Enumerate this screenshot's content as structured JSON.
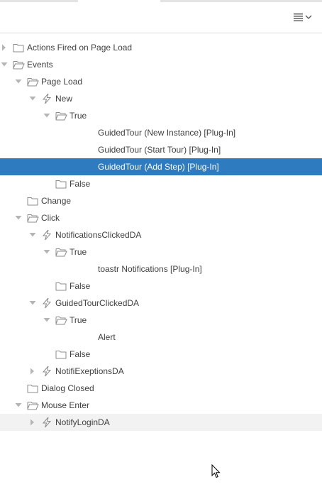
{
  "toolbar": {
    "menu_icon": "hamburger-list-icon",
    "dropdown_icon": "chevron-down-icon"
  },
  "tree": {
    "nodes": [
      {
        "label": "Actions Fired on Page Load",
        "icon": "folder-closed-icon",
        "toggle": "collapsed"
      },
      {
        "label": "Events",
        "icon": "folder-open-icon",
        "toggle": "expanded"
      },
      {
        "label": "Page Load",
        "icon": "folder-open-icon",
        "toggle": "expanded"
      },
      {
        "label": "New",
        "icon": "lightning-icon",
        "toggle": "expanded"
      },
      {
        "label": "True",
        "icon": "folder-open-icon",
        "toggle": "expanded"
      },
      {
        "label": "GuidedTour (New Instance) [Plug-In]"
      },
      {
        "label": "GuidedTour (Start Tour) [Plug-In]"
      },
      {
        "label": "GuidedTour (Add Step) [Plug-In]",
        "selected": true
      },
      {
        "label": "False",
        "icon": "folder-closed-icon"
      },
      {
        "label": "Change",
        "icon": "folder-closed-icon"
      },
      {
        "label": "Click",
        "icon": "folder-open-icon",
        "toggle": "expanded"
      },
      {
        "label": "NotificationsClickedDA",
        "icon": "lightning-icon",
        "toggle": "expanded"
      },
      {
        "label": "True",
        "icon": "folder-open-icon",
        "toggle": "expanded"
      },
      {
        "label": "toastr Notifications [Plug-In]"
      },
      {
        "label": "False",
        "icon": "folder-closed-icon"
      },
      {
        "label": "GuidedTourClickedDA",
        "icon": "lightning-icon",
        "toggle": "expanded"
      },
      {
        "label": "True",
        "icon": "folder-open-icon",
        "toggle": "expanded"
      },
      {
        "label": "Alert"
      },
      {
        "label": "False",
        "icon": "folder-closed-icon"
      },
      {
        "label": "NotifiExeptionsDA",
        "icon": "lightning-icon",
        "toggle": "collapsed"
      },
      {
        "label": "Dialog Closed",
        "icon": "folder-closed-icon"
      },
      {
        "label": "Mouse Enter",
        "icon": "folder-open-icon",
        "toggle": "expanded"
      },
      {
        "label": "NotifyLoginDA",
        "icon": "lightning-icon",
        "toggle": "collapsed",
        "hovered": true
      }
    ]
  },
  "colors": {
    "selected_bg": "#2f7bbf",
    "hover_bg": "#f2f2f2",
    "icon": "#8c8c8c"
  }
}
